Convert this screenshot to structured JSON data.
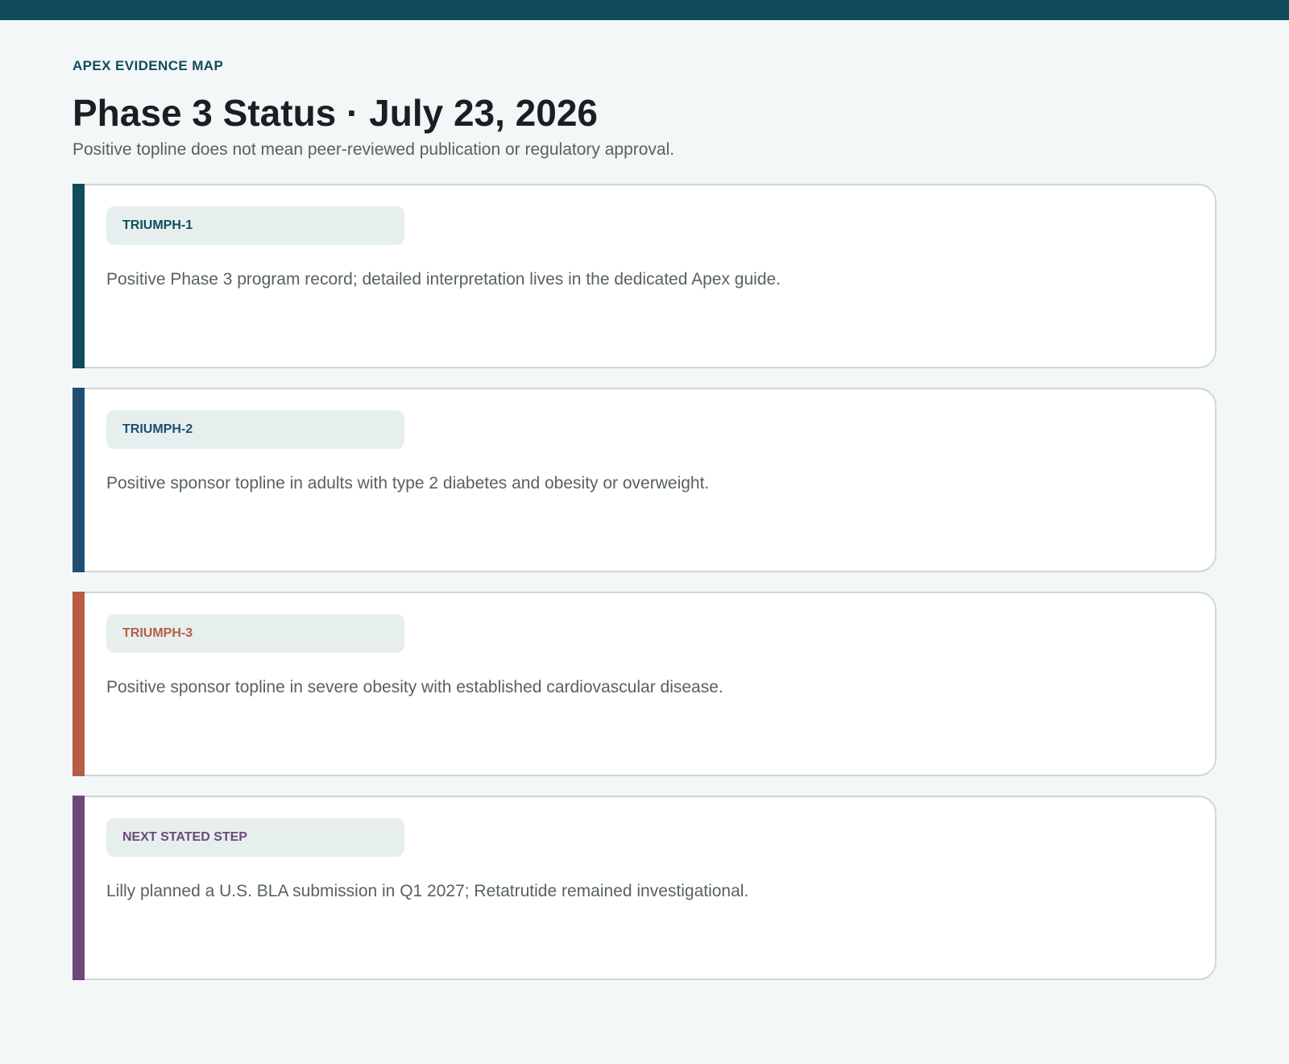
{
  "header": {
    "eyebrow": "APEX EVIDENCE MAP",
    "title": "Phase 3 Status · July 23, 2026",
    "subtitle": "Positive topline does not mean peer-reviewed publication or regulatory approval."
  },
  "colors": {
    "top_bar": "#114c5d",
    "background": "#f3f7f8"
  },
  "cards": [
    {
      "tag": "TRIUMPH-1",
      "text": "Positive Phase 3 program record; detailed interpretation lives in the dedicated Apex guide.",
      "accent_color": "#114c5d",
      "tag_color": "#114c5d"
    },
    {
      "tag": "TRIUMPH-2",
      "text": "Positive sponsor topline in adults with type 2 diabetes and obesity or overweight.",
      "accent_color": "#1e4e72",
      "tag_color": "#1e4e72"
    },
    {
      "tag": "TRIUMPH-3",
      "text": "Positive sponsor topline in severe obesity with established cardiovascular disease.",
      "accent_color": "#b85c45",
      "tag_color": "#b85c45"
    },
    {
      "tag": "NEXT STATED STEP",
      "text": "Lilly planned a U.S. BLA submission in Q1 2027; Retatrutide remained investigational.",
      "accent_color": "#6b4a7a",
      "tag_color": "#6b4a7a"
    }
  ]
}
